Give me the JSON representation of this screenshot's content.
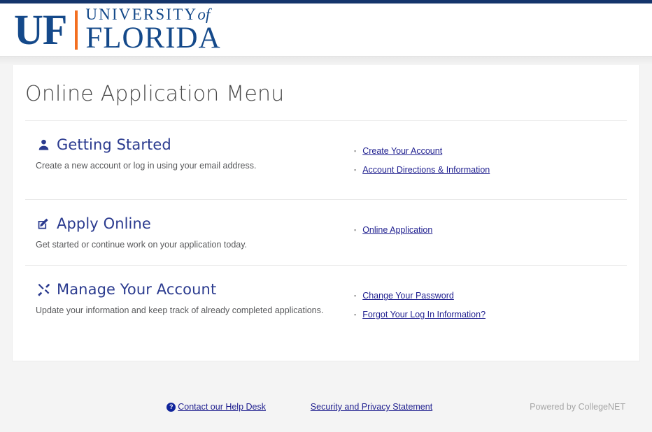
{
  "topbar": {
    "color": "#15356b"
  },
  "brand": {
    "mark": "UF",
    "university": "UNIVERSITY",
    "of": "of",
    "florida": "FLORIDA",
    "accent_color": "#f36f21",
    "blue": "#14498a"
  },
  "page": {
    "title": "Online Application Menu"
  },
  "sections": [
    {
      "icon": "user-icon",
      "heading": "Getting Started",
      "description": "Create a new account or log in using your email address.",
      "links": [
        "Create Your Account",
        "Account Directions & Information"
      ]
    },
    {
      "icon": "pencil-square-icon",
      "heading": "Apply Online",
      "description": "Get started or continue work on your application today.",
      "links": [
        "Online Application"
      ]
    },
    {
      "icon": "tools-icon",
      "heading": "Manage Your Account",
      "description": "Update your information and keep track of already completed applications.",
      "links": [
        "Change Your Password",
        "Forgot Your Log In Information?"
      ]
    }
  ],
  "footer": {
    "help_icon": "question-circle-icon",
    "help_label": "Contact our Help Desk",
    "security_label": "Security and Privacy Statement",
    "powered_by": "Powered by CollegeNET"
  }
}
